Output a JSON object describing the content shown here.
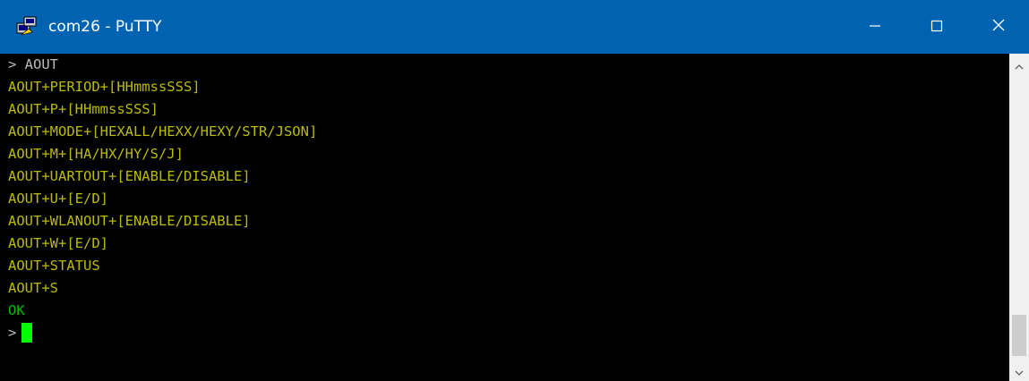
{
  "window": {
    "title": "com26 - PuTTY",
    "icon": "putty-terminal-icon"
  },
  "controls": {
    "minimize_icon": "minimize-icon",
    "maximize_icon": "maximize-icon",
    "close_icon": "close-icon"
  },
  "colors": {
    "titlebar": "#0063b1",
    "terminal_bg": "#000000",
    "prompt_text": "#bbbbbb",
    "output_text": "#bbbb00",
    "ok_text": "#00bb00",
    "cursor": "#00ff00"
  },
  "terminal": {
    "lines": [
      {
        "text": "> AOUT",
        "color": "gray"
      },
      {
        "text": "AOUT+PERIOD+[HHmmssSSS]",
        "color": "yellow"
      },
      {
        "text": "AOUT+P+[HHmmssSSS]",
        "color": "yellow"
      },
      {
        "text": "AOUT+MODE+[HEXALL/HEXX/HEXY/STR/JSON]",
        "color": "yellow"
      },
      {
        "text": "AOUT+M+[HA/HX/HY/S/J]",
        "color": "yellow"
      },
      {
        "text": "AOUT+UARTOUT+[ENABLE/DISABLE]",
        "color": "yellow"
      },
      {
        "text": "AOUT+U+[E/D]",
        "color": "yellow"
      },
      {
        "text": "AOUT+WLANOUT+[ENABLE/DISABLE]",
        "color": "yellow"
      },
      {
        "text": "AOUT+W+[E/D]",
        "color": "yellow"
      },
      {
        "text": "AOUT+STATUS",
        "color": "yellow"
      },
      {
        "text": "AOUT+S",
        "color": "yellow"
      },
      {
        "text": "OK",
        "color": "green"
      }
    ],
    "prompt": ">"
  }
}
